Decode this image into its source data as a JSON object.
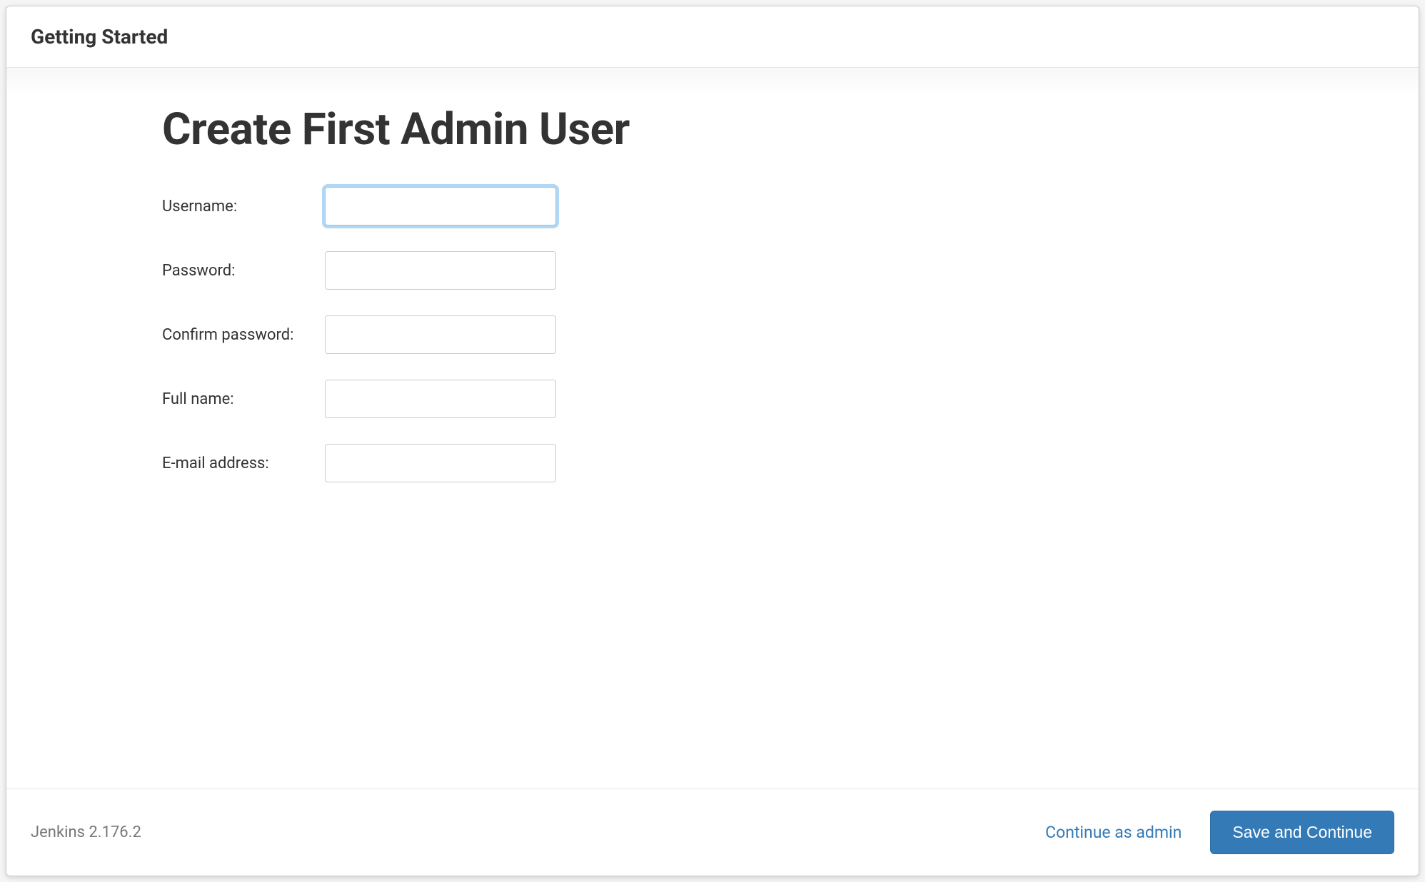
{
  "header": {
    "title": "Getting Started"
  },
  "main": {
    "title": "Create First Admin User",
    "fields": [
      {
        "label": "Username:",
        "value": "",
        "type": "text",
        "focused": true
      },
      {
        "label": "Password:",
        "value": "",
        "type": "password",
        "focused": false
      },
      {
        "label": "Confirm password:",
        "value": "",
        "type": "password",
        "focused": false
      },
      {
        "label": "Full name:",
        "value": "",
        "type": "text",
        "focused": false
      },
      {
        "label": "E-mail address:",
        "value": "",
        "type": "text",
        "focused": false
      }
    ]
  },
  "footer": {
    "version": "Jenkins 2.176.2",
    "continue_link": "Continue as admin",
    "save_button": "Save and Continue"
  }
}
